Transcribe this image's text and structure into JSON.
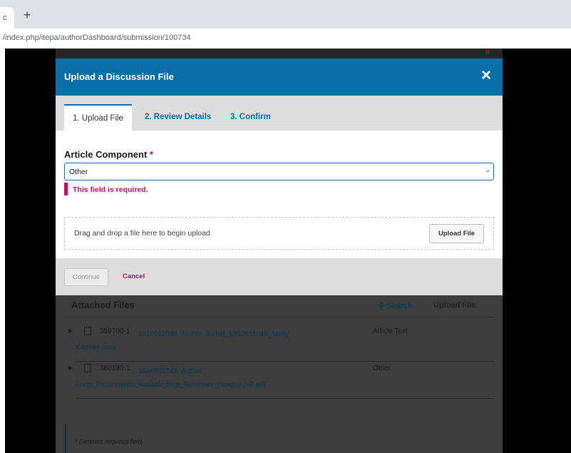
{
  "browser": {
    "tab_fragment": "c",
    "new_tab_label": "+",
    "url": "/index.php/itepa/authorDashboard/submission/100734"
  },
  "modal": {
    "title": "Upload a Discussion File",
    "close_icon": "×",
    "tabs": [
      {
        "label": "1. Upload File",
        "active": true
      },
      {
        "label": "2. Review Details",
        "active": false
      },
      {
        "label": "3. Confirm",
        "active": false
      }
    ],
    "field": {
      "label": "Article Component",
      "required_marker": "*",
      "value": "Other",
      "error": "This field is required."
    },
    "dropzone": {
      "text": "Drag and drop a file here to begin upload",
      "button": "Upload File"
    },
    "footer": {
      "continue": "Continue",
      "cancel": "Cancel"
    }
  },
  "attached_files": {
    "title": "Attached Files",
    "search": "Search",
    "upload": "Upload File",
    "rows": [
      {
        "id": "359700-1",
        "name": "1910511049, Author, Jurnal_1910511049_Melly Karmila.docx",
        "type": "Article Text"
      },
      {
        "id": "360130-1",
        "name": "1910511049, Author, Form_Persetujuan_Naskah_bagi_Reviewer_Penguji 2-2.pdf",
        "type": "Other"
      }
    ],
    "required_note": "* Denotes required field"
  },
  "colors": {
    "header_blue": "#0a6fa6",
    "error_pink": "#d00a6c"
  }
}
